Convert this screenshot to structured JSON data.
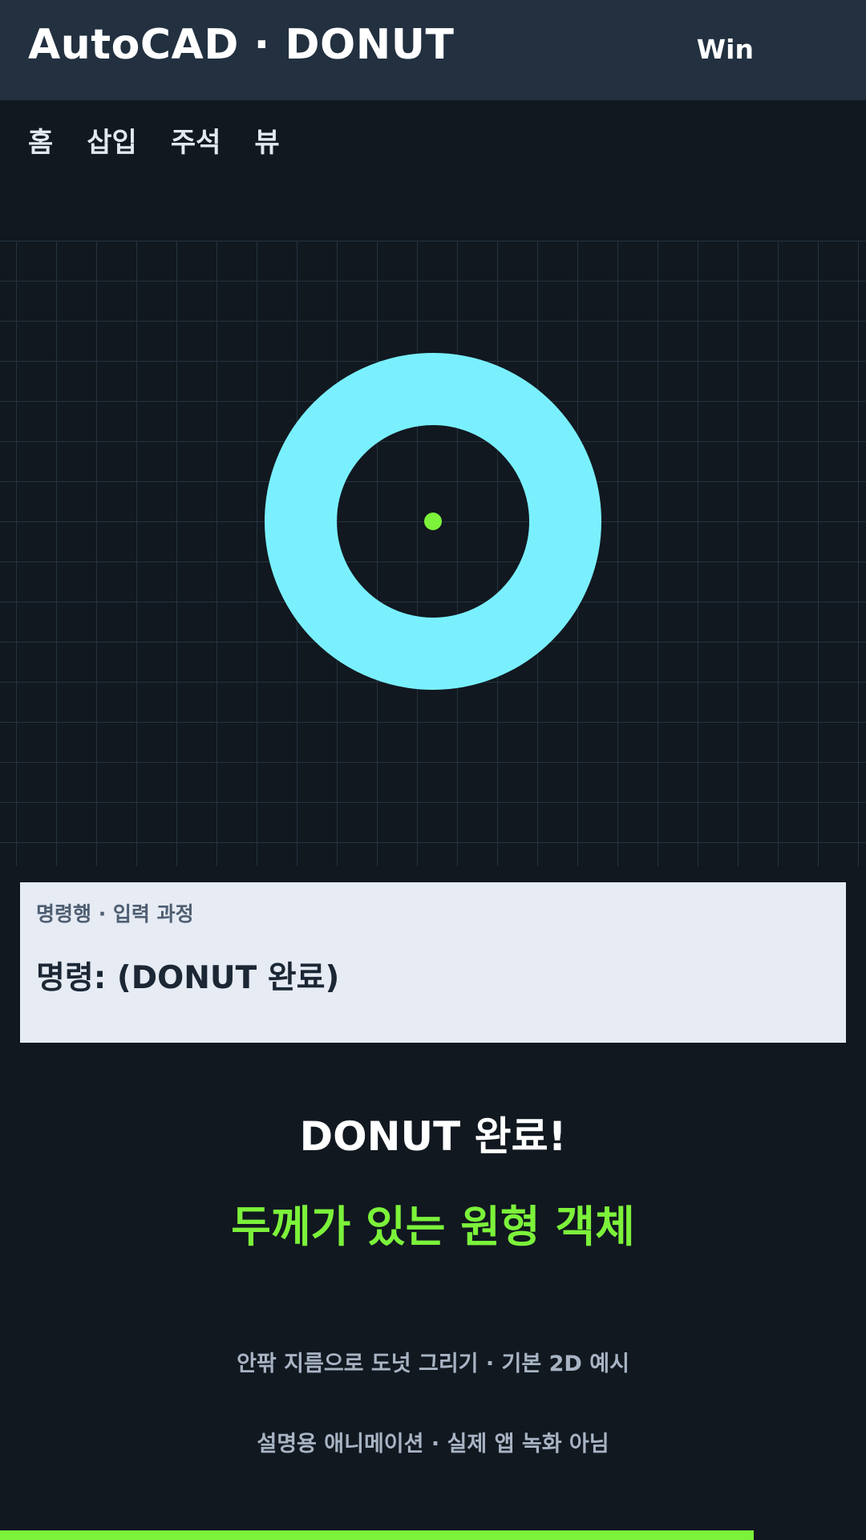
{
  "header": {
    "title": "AutoCAD · DONUT",
    "platform": "Win"
  },
  "ribbon": {
    "tabs": [
      {
        "label": "홈"
      },
      {
        "label": "삽입"
      },
      {
        "label": "주석"
      },
      {
        "label": "뷰"
      }
    ]
  },
  "canvas": {
    "donut_color": "#7af0ff",
    "center_color": "#7cf23a"
  },
  "command": {
    "label": "명령행 · 입력 과정",
    "text": "명령: (DONUT 완료)"
  },
  "result": {
    "headline": "DONUT 완료!",
    "subhead": "두께가 있는 원형 객체"
  },
  "notes": {
    "line1": "안팎 지름으로 도넛 그리기 · 기본 2D 예시",
    "line2": "설명용 애니메이션 · 실제 앱 녹화 아님"
  },
  "progress": {
    "fraction": 0.87,
    "color": "#7cf23a"
  }
}
